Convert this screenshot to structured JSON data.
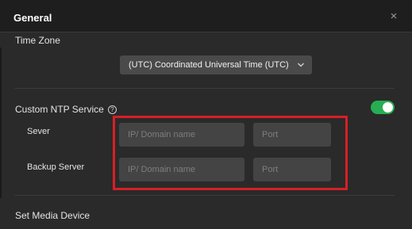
{
  "header": {
    "title": "General",
    "close_glyph": "×"
  },
  "time_zone": {
    "label": "Time Zone",
    "selected_value": "(UTC) Coordinated Universal Time (UTC)"
  },
  "ntp": {
    "label": "Custom NTP Service",
    "help_glyph": "?",
    "enabled": true,
    "toggle_color": "#27ae52",
    "server": {
      "label": "Sever",
      "ip_placeholder": "IP/ Domain name",
      "port_placeholder": "Port"
    },
    "backup_server": {
      "label": "Backup Server",
      "ip_placeholder": "IP/ Domain name",
      "port_placeholder": "Port"
    },
    "highlight_color": "#d81f26"
  },
  "media": {
    "label": "Set Media Device"
  },
  "icons": [
    "close-icon",
    "chevron-down-icon",
    "help-icon"
  ]
}
